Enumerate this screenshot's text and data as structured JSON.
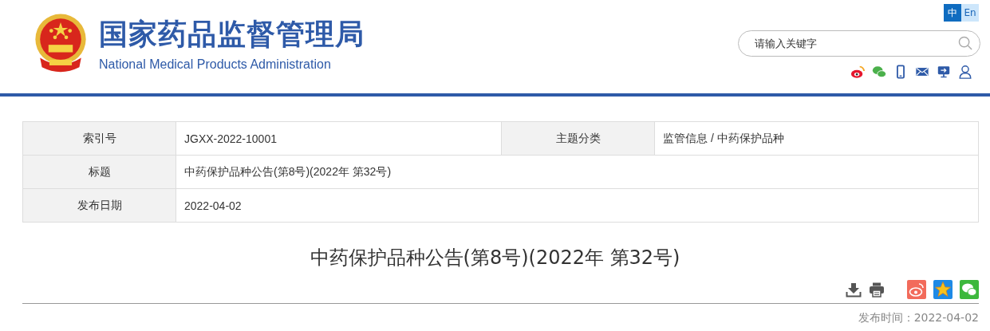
{
  "header": {
    "title_cn": "国家药品监督管理局",
    "title_en": "National Medical Products Administration",
    "languages": [
      {
        "label": "中",
        "selected": true
      },
      {
        "label": "En",
        "selected": false
      }
    ],
    "search": {
      "placeholder": "请输入关键字"
    }
  },
  "info_table": {
    "rows": [
      {
        "cells": [
          {
            "label": "索引号",
            "value": "JGXX-2022-10001"
          },
          {
            "label": "主题分类",
            "value": "监管信息 / 中药保护品种"
          }
        ]
      },
      {
        "cells": [
          {
            "label": "标题",
            "value": "中药保护品种公告(第8号)(2022年 第32号)"
          }
        ]
      },
      {
        "cells": [
          {
            "label": "发布日期",
            "value": "2022-04-02"
          }
        ]
      }
    ]
  },
  "article": {
    "title": "中药保护品种公告(第8号)(2022年 第32号)",
    "publish_time": "发布时间：2022-04-02"
  }
}
